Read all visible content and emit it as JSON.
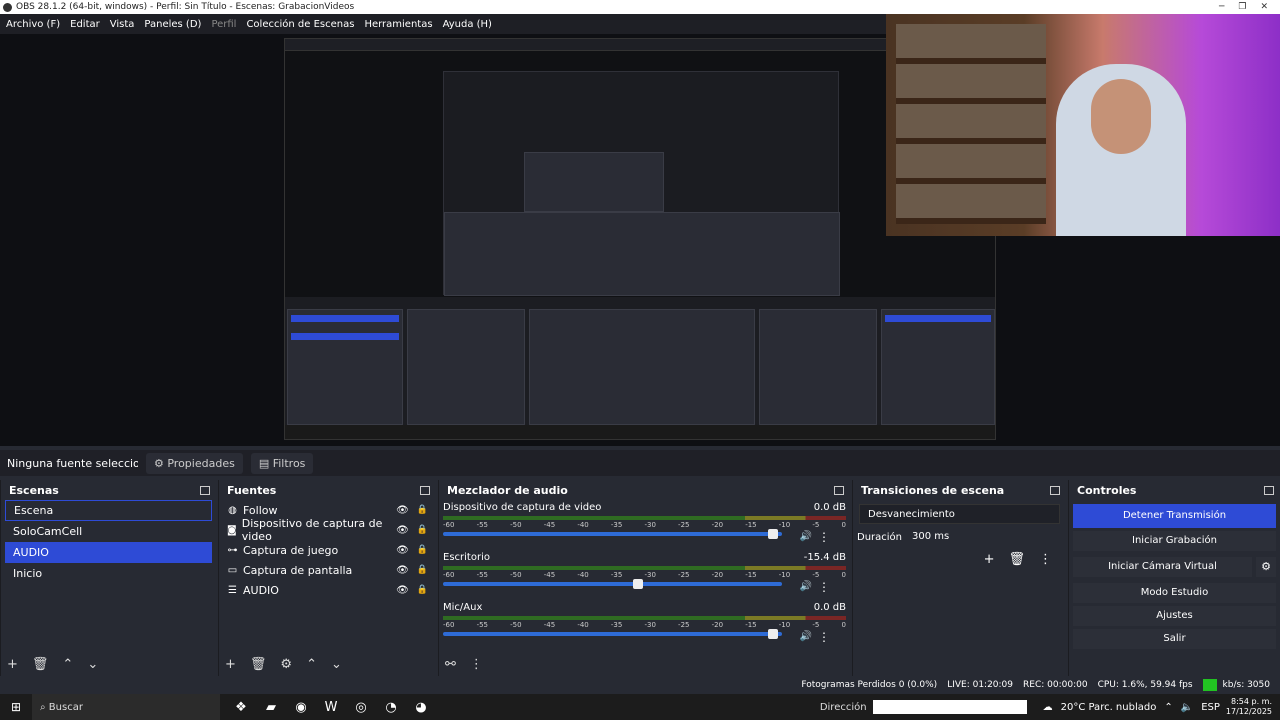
{
  "window": {
    "title": "OBS 28.1.2 (64-bit, windows) - Perfil: Sin Título - Escenas: GrabacionVideos"
  },
  "menu": [
    {
      "label": "Archivo (F)",
      "disabled": false
    },
    {
      "label": "Editar",
      "disabled": false
    },
    {
      "label": "Vista",
      "disabled": false
    },
    {
      "label": "Paneles (D)",
      "disabled": false
    },
    {
      "label": "Perfil",
      "disabled": true
    },
    {
      "label": "Colección de Escenas",
      "disabled": false
    },
    {
      "label": "Herramientas",
      "disabled": false
    },
    {
      "label": "Ayuda (H)",
      "disabled": false
    }
  ],
  "props_bar": {
    "no_source": "Ninguna fuente seleccionada",
    "properties": "Propiedades",
    "filters": "Filtros"
  },
  "scenes": {
    "title": "Escenas",
    "items": [
      {
        "label": "Escena",
        "state": "outline"
      },
      {
        "label": "SoloCamCell",
        "state": ""
      },
      {
        "label": "AUDIO",
        "state": "active"
      },
      {
        "label": "Inicio",
        "state": ""
      }
    ]
  },
  "sources": {
    "title": "Fuentes",
    "items": [
      {
        "label": "Follow",
        "icon": "globe-icon",
        "glyph": "◍"
      },
      {
        "label": "Dispositivo de captura de video",
        "icon": "camera-icon",
        "glyph": "◙"
      },
      {
        "label": "Captura de juego",
        "icon": "gamepad-icon",
        "glyph": "⊶"
      },
      {
        "label": "Captura de pantalla",
        "icon": "monitor-icon",
        "glyph": "▭"
      },
      {
        "label": "AUDIO",
        "icon": "list-icon",
        "glyph": "☰"
      }
    ]
  },
  "mixer": {
    "title": "Mezclador de audio",
    "channels": [
      {
        "name": "Dispositivo de captura de video",
        "db": "0.0 dB",
        "level": 0.96
      },
      {
        "name": "Escritorio",
        "db": "-15.4 dB",
        "level": 0.56
      },
      {
        "name": "Mic/Aux",
        "db": "0.0 dB",
        "level": 0.96
      }
    ],
    "ticks": [
      "-60",
      "-55",
      "-50",
      "-45",
      "-40",
      "-35",
      "-30",
      "-25",
      "-20",
      "-15",
      "-10",
      "-5",
      "0"
    ]
  },
  "transitions": {
    "title": "Transiciones de escena",
    "selected": "Desvanecimiento",
    "duration_label": "Duración",
    "duration_value": "300 ms"
  },
  "controls": {
    "title": "Controles",
    "stop_stream": "Detener Transmisión",
    "start_recording": "Iniciar Grabación",
    "start_virtual_cam": "Iniciar Cámara Virtual",
    "studio_mode": "Modo Estudio",
    "settings": "Ajustes",
    "exit": "Salir"
  },
  "status": {
    "dropped": "Fotogramas Perdidos 0 (0.0%)",
    "live": "LIVE: 01:20:09",
    "rec": "REC: 00:00:00",
    "cpu": "CPU: 1.6%, 59.94 fps",
    "kbs": "kb/s: 3050"
  },
  "taskbar": {
    "search": "Buscar",
    "direccion": "Dirección",
    "weather": "20°C  Parc. nublado",
    "lang": "ESP",
    "time": "8:54 p. m.",
    "date": "17/12/2025"
  }
}
